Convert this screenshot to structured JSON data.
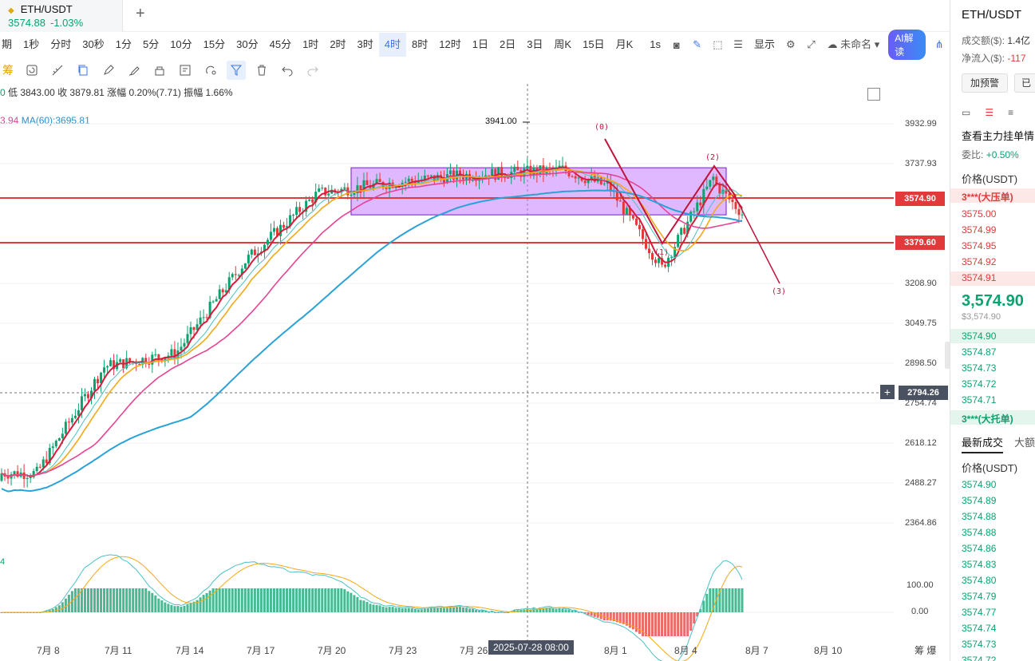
{
  "tab": {
    "symbol": "ETH/USDT",
    "price": "3574.88",
    "change": "-1.03%",
    "add": "+"
  },
  "intervals": {
    "items": [
      "期",
      "1秒",
      "分时",
      "30秒",
      "1分",
      "5分",
      "10分",
      "15分",
      "30分",
      "45分",
      "1时",
      "2时",
      "3时",
      "4时",
      "8时",
      "12时",
      "1日",
      "2日",
      "3日",
      "周K",
      "15日",
      "月K"
    ],
    "active_index": 13,
    "seconds_label": "1s",
    "display_label": "显示",
    "layout_label": "未命名",
    "ai_label": "AI解读"
  },
  "tools": {
    "chou": "筹"
  },
  "stats": {
    "prefix": "0",
    "low": "低 3843.00",
    "close": "收 3879.81",
    "change": "涨幅 0.20%(7.71)",
    "amp": "振幅 1.66%"
  },
  "ma": {
    "left": "3.94",
    "ma60": "MA(60):3695.81"
  },
  "chart": {
    "high_label": "3941.00",
    "price_axis": [
      "3932.99",
      "3737.93",
      "3208.90",
      "3049.75",
      "2898.50",
      "2754.74",
      "2618.12",
      "2488.27",
      "2364.86"
    ],
    "tag_resistance": "3574.90",
    "tag_support": "3379.60",
    "tag_cursor": "2794.26",
    "cursor_plus": "+",
    "macd_axis": [
      "100.00",
      "0.00"
    ],
    "macd_label_left": "4",
    "dates": [
      "7月 8",
      "7月 11",
      "7月 14",
      "7月 17",
      "7月 20",
      "7月 23",
      "7月 26",
      "8月 1",
      "8月 4",
      "8月 7",
      "8月 10"
    ],
    "cursor_date": "2025-07-28 08:00",
    "bottom_right": "筹 爆",
    "wave_labels": [
      "(0)",
      "(1)",
      "(2)",
      "(3)"
    ],
    "colors": {
      "up": "#0aa36f",
      "down": "#e23a3a",
      "ma_fast": "#d81b3c",
      "ma_mid": "#f4a916",
      "ma_slow": "#e84393",
      "ma_long": "#2aa2d8",
      "box": "#c77dff"
    }
  },
  "chart_data": {
    "type": "candlestick",
    "title": "ETH/USDT 4时",
    "ylim": [
      2300,
      4000
    ],
    "x": [
      "7月 8",
      "7月 11",
      "7月 14",
      "7月 17",
      "7月 20",
      "7月 23",
      "7月 26",
      "8月 1",
      "8月 4",
      "8月 7"
    ],
    "close_approx": [
      2560,
      2980,
      3030,
      3400,
      3660,
      3700,
      3730,
      3760,
      3400,
      3575
    ],
    "series": [
      {
        "name": "MA(60)",
        "values": [
          2490,
          2560,
          2760,
          2980,
          3280,
          3560,
          3680,
          3720,
          3720,
          3695.81
        ]
      }
    ],
    "levels": [
      3574.9,
      3379.6
    ],
    "high": 3941.0
  },
  "right_panel": {
    "title": "ETH/USDT",
    "volume_label": "成交额($):",
    "volume_value": "1.4亿",
    "inflow_label": "净流入($):",
    "inflow_value": "-117",
    "alert_btn": "加预警",
    "second_btn": "已",
    "orderbook_link": "查看主力挂单情",
    "weibi_label": "委比:",
    "weibi_value": "+0.50%",
    "price_header": "价格(USDT)",
    "ask_big": "3***(大压单)",
    "asks": [
      "3575.00",
      "3574.99",
      "3574.95",
      "3574.92",
      "3574.91"
    ],
    "last_price": "3,574.90",
    "last_price_usd": "$3,574.90",
    "bids": [
      "3574.90",
      "3574.87",
      "3574.73",
      "3574.72",
      "3574.71"
    ],
    "bid_big": "3***(大托单)",
    "trades_tab": "最新成交",
    "trades_tab2": "大额",
    "trades_header": "价格(USDT)",
    "trades": [
      "3574.90",
      "3574.89",
      "3574.88",
      "3574.88",
      "3574.86",
      "3574.83",
      "3574.80",
      "3574.79",
      "3574.77",
      "3574.74",
      "3574.73",
      "3574.72"
    ]
  }
}
